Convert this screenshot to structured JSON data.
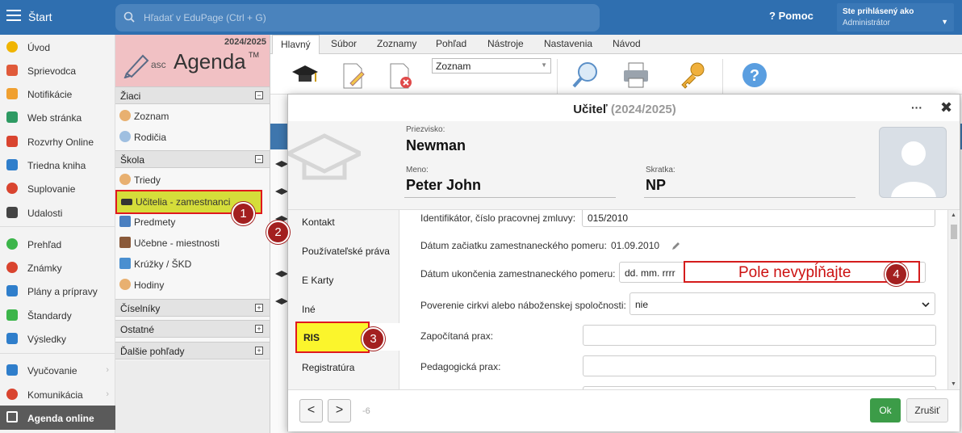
{
  "topbar": {
    "start": "Štart",
    "search_placeholder": "Hľadať v EduPage (Ctrl + G)",
    "help": "Pomoc",
    "user_line1": "Ste prihlásený ako",
    "user_line2": "Administrátor"
  },
  "leftnav": [
    {
      "label": "Úvod",
      "color": "#f0b400"
    },
    {
      "label": "Sprievodca",
      "color": "#e05a3a"
    },
    {
      "label": "Notifikácie",
      "color": "#f0a030"
    },
    {
      "label": "Web stránka",
      "color": "#2e9a63"
    },
    {
      "label": "Rozvrhy Online",
      "color": "#d9442f"
    },
    {
      "label": "Triedna kniha",
      "color": "#2f7ecb"
    },
    {
      "label": "Suplovanie",
      "color": "#d9442f"
    },
    {
      "label": "Udalosti",
      "color": "#444444"
    },
    {
      "label": "Prehľad",
      "color": "#3cb54a"
    },
    {
      "label": "Známky",
      "color": "#d9442f"
    },
    {
      "label": "Plány a prípravy",
      "color": "#2f7ecb"
    },
    {
      "label": "Štandardy",
      "color": "#3cb54a"
    },
    {
      "label": "Výsledky",
      "color": "#2f7ecb"
    },
    {
      "label": "Vyučovanie",
      "color": "#2f7ecb"
    },
    {
      "label": "Komunikácia",
      "color": "#d9442f"
    },
    {
      "label": "Agenda online",
      "color": "#ffffff"
    }
  ],
  "agenda": {
    "year": "2024/2025",
    "logo_asc": "asc",
    "logo_name": "Agenda",
    "logo_tm": "TM",
    "sections": {
      "ziaci": "Žiaci",
      "skola": "Škola",
      "ciselniky": "Číselníky",
      "ostatne": "Ostatné",
      "dalsie": "Ďalšie pohľady"
    },
    "items": {
      "zoznam": "Zoznam",
      "rodicia": "Rodičia",
      "triedy": "Triedy",
      "ucitelia": "Učitelia - zamestnanci",
      "predmety": "Predmety",
      "ucebne": "Učebne - miestnosti",
      "kruzky": "Krúžky / ŠKD",
      "hodiny": "Hodiny"
    }
  },
  "ribbon": {
    "tabs": [
      "Hlavný",
      "Súbor",
      "Zoznamy",
      "Pohľad",
      "Nástroje",
      "Nastavenia",
      "Návod"
    ],
    "view_select": "Zoznam"
  },
  "modal": {
    "title": "Učiteľ",
    "year": "(2024/2025)",
    "dots": "···",
    "close": "✖",
    "surname_label": "Priezvisko:",
    "surname": "Newman",
    "name_label": "Meno:",
    "name": "Peter John",
    "abbr_label": "Skratka:",
    "abbr": "NP",
    "side_tabs": [
      "Kontakt",
      "Používateľské práva",
      "E Karty",
      "Iné",
      "RIS",
      "Registratúra"
    ],
    "form": {
      "id_label": "Identifikátor, číslo pracovnej zmluvy:",
      "id_value": "015/2010",
      "start_label": "Dátum začiatku zamestnaneckého pomeru:",
      "start_value": "01.09.2010",
      "end_label": "Dátum ukončenia zamestnaneckého pomeru:",
      "end_placeholder": "dd. mm. rrrr",
      "church_label": "Poverenie cirkvi alebo náboženskej spoločnosti:",
      "church_value": "nie",
      "prax_label": "Započítaná prax:",
      "ped_label": "Pedagogická prax:"
    },
    "annotation": "Pole nevypĺňajte",
    "footer": {
      "prev": "<",
      "next": ">",
      "counter": "-6",
      "ok": "Ok",
      "cancel": "Zrušiť"
    }
  },
  "badges": [
    "1",
    "2",
    "3",
    "4"
  ]
}
